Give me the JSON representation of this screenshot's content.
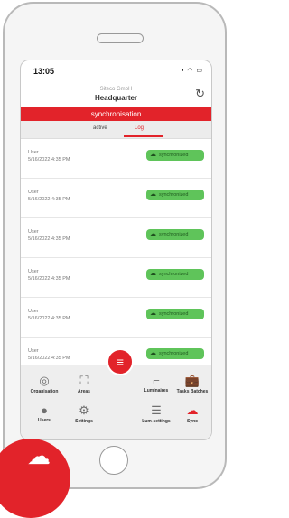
{
  "status": {
    "time": "13:05",
    "icons": "▪︎ ◠ ▭"
  },
  "header": {
    "company": "Siteco GmbH",
    "title": "Headquarter"
  },
  "banner": "synchronisation",
  "tabs": {
    "active": "active",
    "log": "Log"
  },
  "rows": [
    {
      "user": "User",
      "date": "5/16/2022 4:35 PM",
      "status": "synchronized"
    },
    {
      "user": "User",
      "date": "5/16/2022 4:35 PM",
      "status": "synchronized"
    },
    {
      "user": "User",
      "date": "5/16/2022 4:35 PM",
      "status": "synchronized"
    },
    {
      "user": "User",
      "date": "5/16/2022 4:35 PM",
      "status": "synchronized"
    },
    {
      "user": "User",
      "date": "5/16/2022 4:35 PM",
      "status": "synchronized"
    },
    {
      "user": "User",
      "date": "5/16/2022 4:35 PM",
      "status": "synchronized"
    }
  ],
  "nav": {
    "organisation": "Organisation",
    "areas": "Areas",
    "luminaires": "Luminaires",
    "tasks": "Tasks Batches",
    "users": "Users",
    "settings": "Settings",
    "lum_settings": "Lum-settings",
    "sync": "Sync"
  },
  "icons": {
    "refresh": "refresh-icon",
    "menu": "menu-icon",
    "cloud": "cloud-check-icon",
    "organisation": "target-icon",
    "areas": "frame-icon",
    "luminaires": "luminaire-icon",
    "tasks": "briefcase-icon",
    "users": "user-icon",
    "settings": "gear-icon",
    "lum_settings": "sliders-icon",
    "sync": "cloud-sync-icon"
  },
  "colors": {
    "accent": "#e2232a",
    "success": "#5fc45a",
    "nav_bg": "#eeeeee"
  }
}
